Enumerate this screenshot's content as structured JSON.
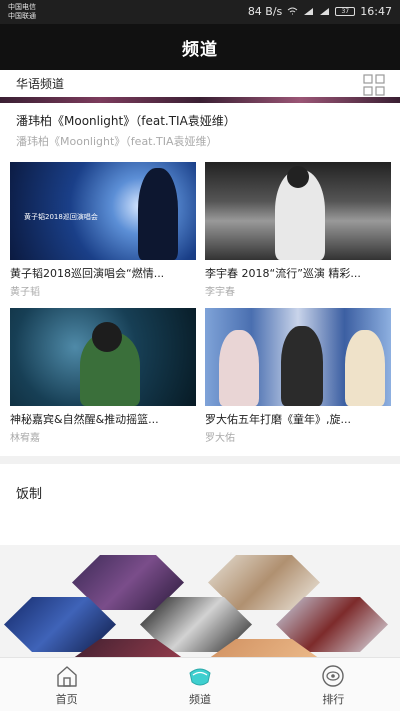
{
  "status_bar": {
    "carrier1": "中国电信",
    "carrier2": "中国联通",
    "speed": "84 B/s",
    "battery": "37",
    "time": "16:47"
  },
  "header": {
    "title": "频道"
  },
  "channel": {
    "name": "华语频道",
    "grid_icon": "grid-icon"
  },
  "featured": {
    "title": "潘玮柏《Moonlight》（feat.TIA袁娅维）",
    "artist": "潘玮柏《Moonlight》（feat.TIA袁娅维）"
  },
  "cards": [
    {
      "title": "黄子韬2018巡回演唱会“燃情...",
      "artist": "黄子韬",
      "thumb_text": "黄子韬2018巡回演唱会"
    },
    {
      "title": "李宇春 2018“流行”巡演 精彩...",
      "artist": "李宇春"
    },
    {
      "title": "神秘嘉宾&自然醒&推动摇篮...",
      "artist": "林宥嘉"
    },
    {
      "title": "罗大佑五年打磨《童年》,旋...",
      "artist": "罗大佑"
    }
  ],
  "fan_section": {
    "title": "饭制"
  },
  "nav": [
    {
      "label": "首页",
      "icon": "home-icon"
    },
    {
      "label": "频道",
      "icon": "channel-icon"
    },
    {
      "label": "排行",
      "icon": "ranking-icon"
    }
  ],
  "colors": {
    "header_bg": "#111111",
    "accent": "#3ecfcf",
    "divider": "#f1f1f1"
  }
}
